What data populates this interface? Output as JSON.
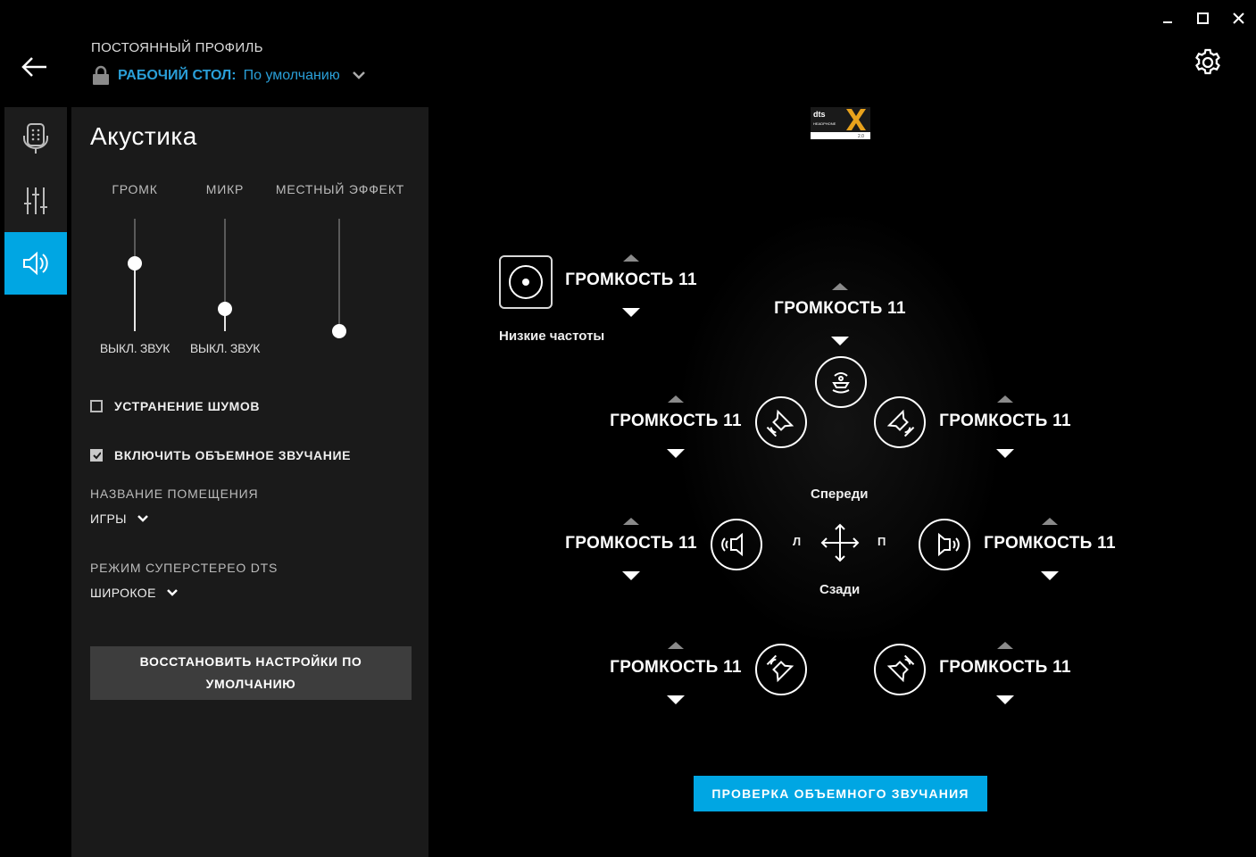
{
  "header": {
    "profile_label": "ПОСТОЯННЫЙ ПРОФИЛЬ",
    "profile_key": "РАБОЧИЙ СТОЛ:",
    "profile_value": "По умолчанию"
  },
  "window_controls": {
    "minimize": "minimize",
    "maximize": "maximize",
    "close": "close"
  },
  "nav": [
    "microphone-device",
    "equalizer",
    "acoustics"
  ],
  "panel": {
    "title": "Акустика",
    "sliders": [
      {
        "label": "ГРОМК",
        "mute_label": "ВЫКЛ. ЗВУК",
        "level": 0.6
      },
      {
        "label": "МИКР",
        "mute_label": "ВЫКЛ. ЗВУК",
        "level": 0.2
      },
      {
        "label": "МЕСТНЫЙ ЭФФЕКТ",
        "mute_label": "",
        "level": 0.0
      }
    ],
    "noise_cancel": {
      "label": "УСТРАНЕНИЕ ШУМОВ",
      "checked": false
    },
    "surround": {
      "label": "ВКЛЮЧИТЬ ОБЪЕМНОЕ ЗВУЧАНИЕ",
      "checked": true
    },
    "room": {
      "label": "НАЗВАНИЕ ПОМЕЩЕНИЯ",
      "value": "ИГРЫ"
    },
    "stereo": {
      "label": "РЕЖИМ СУПЕРСТЕРЕО DTS",
      "value": "ШИРОКОЕ"
    },
    "reset_label": "ВОССТАНОВИТЬ НАСТРОЙКИ ПО УМОЛЧАНИЮ"
  },
  "surround_map": {
    "bass_label": "Низкие частоты",
    "front_label": "Спереди",
    "back_label": "Сзади",
    "left_label": "Л",
    "right_label": "П",
    "channels": {
      "bass": "ГРОМКОСТЬ 11",
      "center": "ГРОМКОСТЬ 11",
      "front_left": "ГРОМКОСТЬ 11",
      "front_right": "ГРОМКОСТЬ 11",
      "side_left": "ГРОМКОСТЬ 11",
      "side_right": "ГРОМКОСТЬ 11",
      "rear_left": "ГРОМКОСТЬ 11",
      "rear_right": "ГРОМКОСТЬ 11"
    }
  },
  "test_button": "ПРОВЕРКА ОБЪЕМНОГО ЗВУЧАНИЯ",
  "colors": {
    "accent": "#00a6e3",
    "panel": "#1a1a1a",
    "background": "#000000"
  }
}
